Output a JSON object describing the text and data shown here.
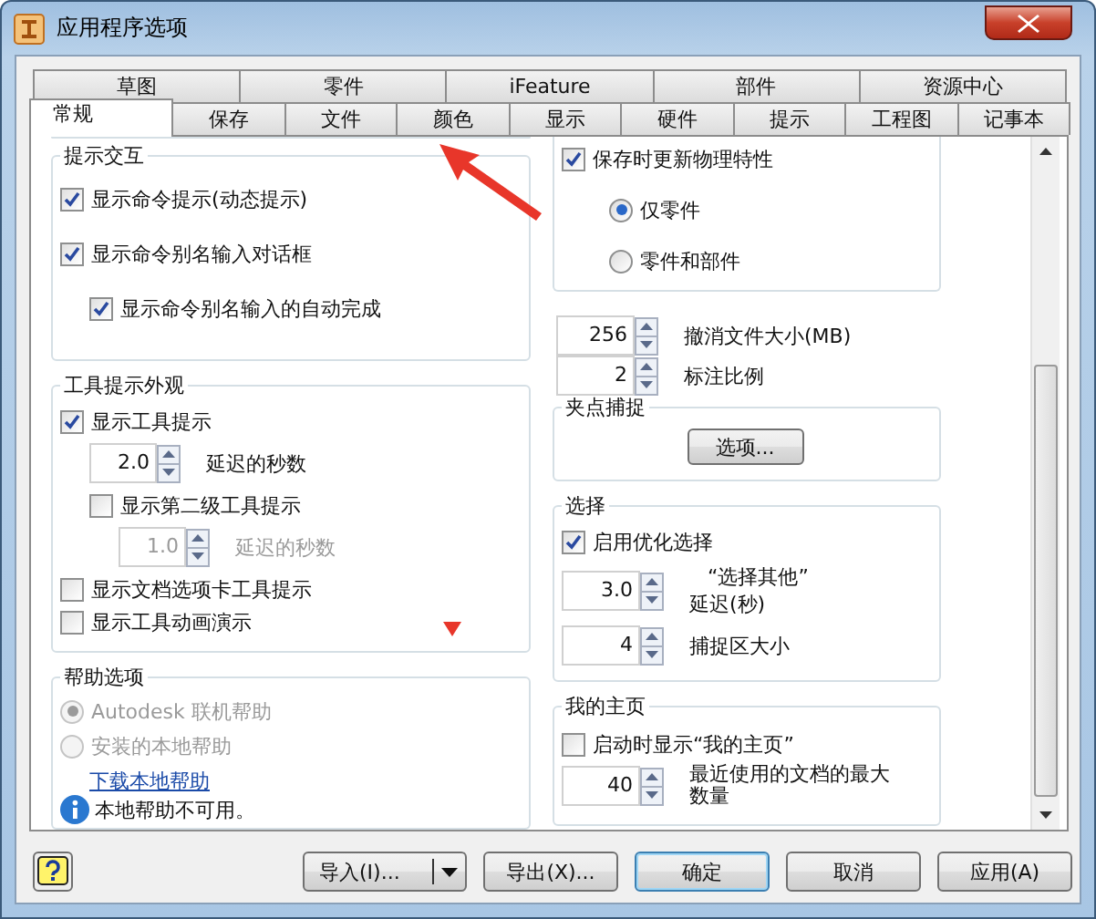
{
  "window": {
    "title": "应用程序选项"
  },
  "tab_rows": [
    {
      "tabs": [
        {
          "label": "草图",
          "selected": false
        },
        {
          "label": "零件",
          "selected": false
        },
        {
          "label": "iFeature",
          "selected": false
        },
        {
          "label": "部件",
          "selected": false
        },
        {
          "label": "资源中心",
          "selected": false
        }
      ]
    },
    {
      "tabs": [
        {
          "label": "常规",
          "selected": true
        },
        {
          "label": "保存",
          "selected": false
        },
        {
          "label": "文件",
          "selected": false
        },
        {
          "label": "颜色",
          "selected": false
        },
        {
          "label": "显示",
          "selected": false
        },
        {
          "label": "硬件",
          "selected": false
        },
        {
          "label": "提示",
          "selected": false
        },
        {
          "label": "工程图",
          "selected": false
        },
        {
          "label": "记事本",
          "selected": false
        }
      ]
    }
  ],
  "left_column": [
    {
      "kind": "group"
    },
    {
      "kind": "group",
      "title": "提示交互",
      "items": [
        {
          "kind": "checkbox",
          "label": "显示命令提示(动态提示)",
          "checked": true
        },
        {
          "kind": "checkbox",
          "label": "显示命令别名输入对话框",
          "checked": true,
          "children": [
            {
              "kind": "checkbox",
              "label": "显示命令别名输入的自动完成",
              "checked": true
            }
          ]
        }
      ]
    },
    {
      "kind": "group",
      "title": "工具提示外观",
      "items": [
        {
          "kind": "checkbox",
          "label": "显示工具提示",
          "checked": true,
          "children": [
            {
              "kind": "spinner",
              "value": "2.0",
              "label": "延迟的秒数",
              "disabled": false
            },
            {
              "kind": "checkbox",
              "label": "显示第二级工具提示",
              "checked": false,
              "children": [
                {
                  "kind": "spinner",
                  "value": "1.0",
                  "label": "延迟的秒数",
                  "disabled": true
                }
              ]
            }
          ]
        },
        {
          "kind": "checkbox",
          "label": "显示文档选项卡工具提示",
          "checked": false
        },
        {
          "kind": "checkbox",
          "label": "显示工具动画演示",
          "checked": false
        }
      ]
    },
    {
      "kind": "group",
      "title": "帮助选项",
      "items": [
        {
          "kind": "radio",
          "label": "Autodesk 联机帮助",
          "selected": true,
          "disabled": true
        },
        {
          "kind": "radio",
          "label": "安装的本地帮助",
          "selected": false,
          "disabled": true
        },
        {
          "kind": "link",
          "text": "下载本地帮助"
        },
        {
          "kind": "info",
          "text": "本地帮助不可用。"
        }
      ]
    }
  ],
  "right_column": [
    {
      "kind": "group",
      "items": [
        {
          "kind": "checkbox",
          "label": "保存时更新物理特性",
          "checked": true,
          "children": [
            {
              "kind": "radio",
              "label": "仅零件",
              "selected": true,
              "disabled": false
            },
            {
              "kind": "radio",
              "label": "零件和部件",
              "selected": false,
              "disabled": false
            }
          ]
        }
      ]
    },
    {
      "kind": "spinner",
      "value": "256",
      "label": "撤消文件大小(MB)",
      "disabled": false
    },
    {
      "kind": "spinner",
      "value": "2",
      "label": "标注比例",
      "disabled": false
    },
    {
      "kind": "group",
      "title": "夹点捕捉",
      "items": [
        {
          "kind": "button",
          "label": "选项..."
        }
      ]
    },
    {
      "kind": "group",
      "title": "选择",
      "items": [
        {
          "kind": "checkbox",
          "label": "启用优化选择",
          "checked": true
        },
        {
          "kind": "spinner",
          "value": "3.0",
          "label_lines": [
            "“选择其他”",
            "延迟(秒)"
          ],
          "disabled": false
        },
        {
          "kind": "spinner",
          "value": "4",
          "label": "捕捉区大小",
          "disabled": false
        }
      ]
    },
    {
      "kind": "group",
      "title": "我的主页",
      "items": [
        {
          "kind": "checkbox",
          "label": "启动时显示“我的主页”",
          "checked": false
        },
        {
          "kind": "spinner",
          "value": "40",
          "label": "最近使用的文档的最大数量",
          "disabled": false
        }
      ]
    }
  ],
  "buttons": [
    {
      "label": "导入(I)...",
      "kind": "split",
      "default": false
    },
    {
      "label": "导出(X)...",
      "kind": "plain",
      "default": false
    },
    {
      "label": "确定",
      "kind": "plain",
      "default": true
    },
    {
      "label": "取消",
      "kind": "plain",
      "default": false
    },
    {
      "label": "应用(A)",
      "kind": "plain",
      "default": false
    }
  ]
}
